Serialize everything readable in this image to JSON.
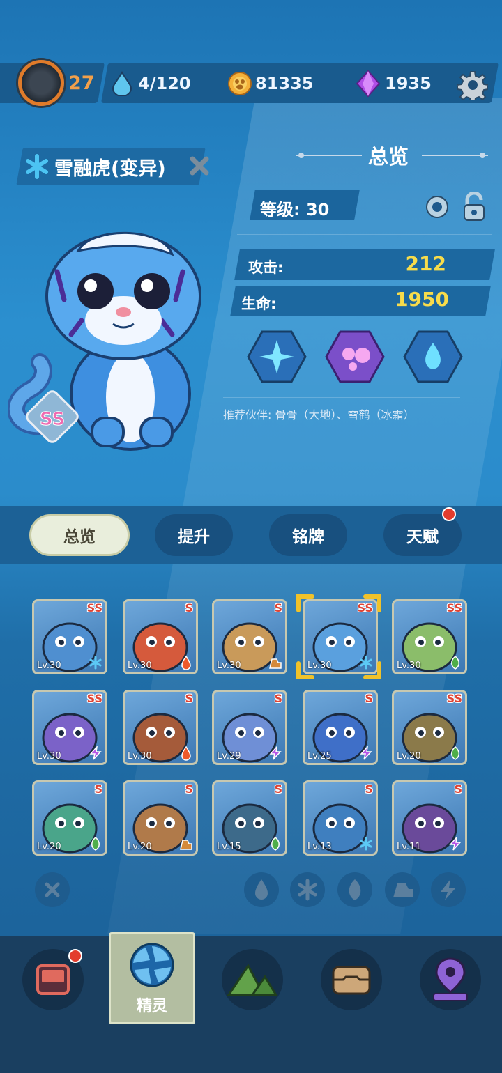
{
  "topbar": {
    "player_level": "27",
    "energy": "4/120",
    "coins": "81335",
    "gems": "1935"
  },
  "pet": {
    "name": "雪融虎(变异)",
    "rarity": "SS",
    "element_icon": "snowflake-icon"
  },
  "overview": {
    "title": "总览",
    "level_label": "等级: 30",
    "attack_label": "攻击:",
    "attack_value": "212",
    "hp_label": "生命:",
    "hp_value": "1950",
    "recommend": "推荐伙伴: 骨骨（大地）、雪鹤（冰霜）"
  },
  "tabs": [
    {
      "label": "总览",
      "active": true
    },
    {
      "label": "提升"
    },
    {
      "label": "铭牌"
    },
    {
      "label": "天赋",
      "badge": true
    }
  ],
  "pets": [
    {
      "rank": "SS",
      "level": "Lv.30",
      "element": "snowflake-icon"
    },
    {
      "rank": "S",
      "level": "Lv.30",
      "element": "fire-icon"
    },
    {
      "rank": "S",
      "level": "Lv.30",
      "element": "earth-icon"
    },
    {
      "rank": "SS",
      "level": "Lv.30",
      "element": "snowflake-icon",
      "selected": true
    },
    {
      "rank": "SS",
      "level": "Lv.30",
      "element": "leaf-icon"
    },
    {
      "rank": "SS",
      "level": "Lv.30",
      "element": "lightning-icon"
    },
    {
      "rank": "S",
      "level": "Lv.30",
      "element": "fire-icon"
    },
    {
      "rank": "S",
      "level": "Lv.29",
      "element": "lightning-icon"
    },
    {
      "rank": "S",
      "level": "Lv.25",
      "element": "lightning-icon"
    },
    {
      "rank": "SS",
      "level": "Lv.20",
      "element": "leaf-icon"
    },
    {
      "rank": "S",
      "level": "Lv.20",
      "element": "leaf-icon"
    },
    {
      "rank": "S",
      "level": "Lv.20",
      "element": "earth-icon"
    },
    {
      "rank": "S",
      "level": "Lv.15",
      "element": "leaf-icon"
    },
    {
      "rank": "S",
      "level": "Lv.13",
      "element": "snowflake-icon"
    },
    {
      "rank": "S",
      "level": "Lv.11",
      "element": "lightning-icon"
    }
  ],
  "bottom_nav": {
    "active_label": "精灵"
  },
  "colors": {
    "rank_red": "#e04434",
    "stat_yellow": "#f7dc4b",
    "level_orange": "#f2a04a"
  }
}
